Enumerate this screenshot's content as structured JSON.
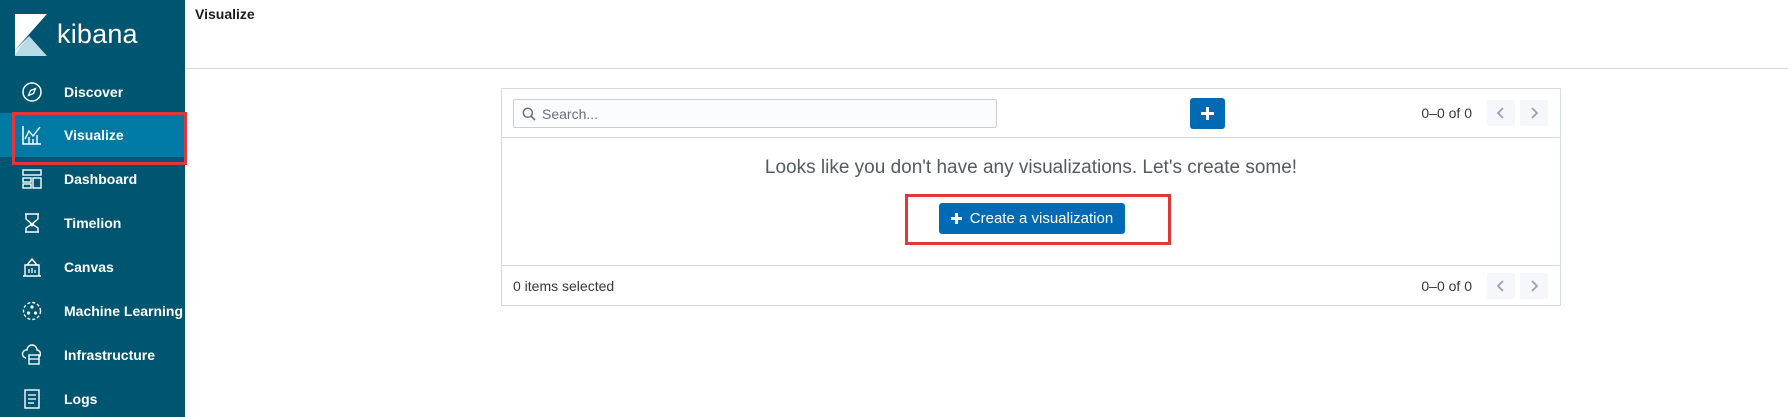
{
  "brand": {
    "name": "kibana"
  },
  "sidebar": {
    "items": [
      {
        "label": "Discover",
        "icon": "compass-icon"
      },
      {
        "label": "Visualize",
        "icon": "visualize-icon",
        "active": true
      },
      {
        "label": "Dashboard",
        "icon": "dashboard-icon"
      },
      {
        "label": "Timelion",
        "icon": "timelion-icon"
      },
      {
        "label": "Canvas",
        "icon": "canvas-icon"
      },
      {
        "label": "Machine Learning",
        "icon": "machine-learning-icon"
      },
      {
        "label": "Infrastructure",
        "icon": "infrastructure-icon"
      },
      {
        "label": "Logs",
        "icon": "logs-icon"
      }
    ]
  },
  "header": {
    "title": "Visualize"
  },
  "toolbar": {
    "search_placeholder": "Search...",
    "pagination": "0–0 of 0"
  },
  "empty_state": {
    "message": "Looks like you don't have any visualizations. Let's create some!",
    "create_label": "Create a visualization"
  },
  "footer": {
    "selected_text": "0 items selected",
    "pagination": "0–0 of 0"
  },
  "colors": {
    "sidebar_bg": "#005571",
    "sidebar_active": "#0079a5",
    "primary": "#006bb4",
    "highlight": "#e0373a"
  }
}
